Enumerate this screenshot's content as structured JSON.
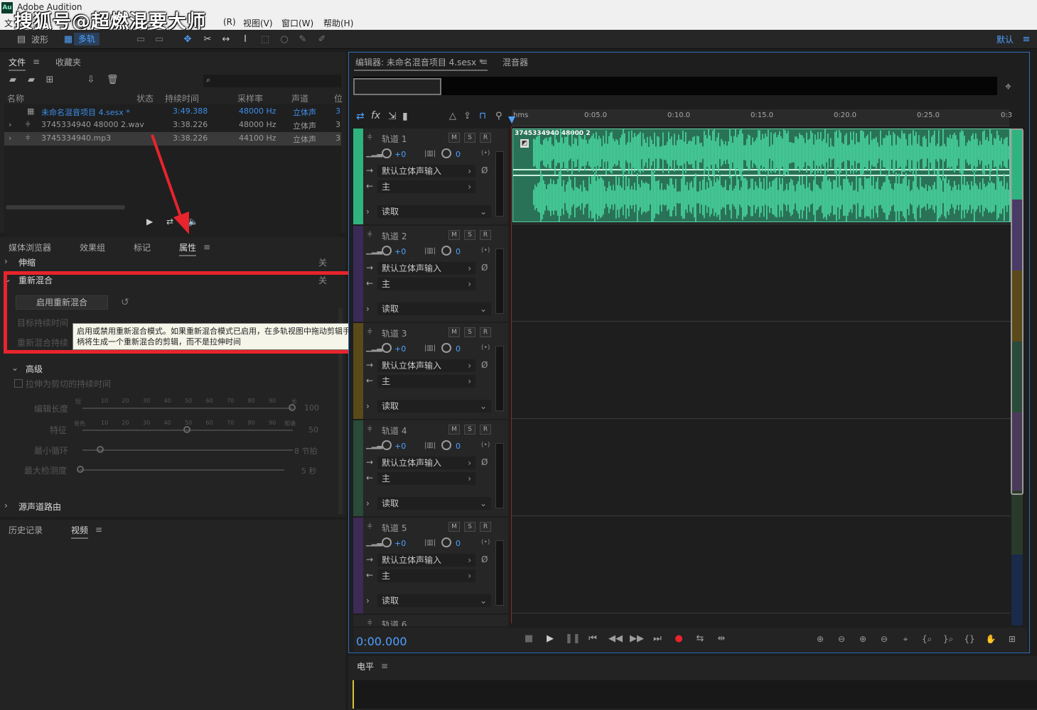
{
  "window": {
    "app_title": "Adobe Audition",
    "logo_text": "Au"
  },
  "watermark": "搜狐号@超燃混要大师",
  "menu": {
    "items": [
      "文",
      "(R)",
      "视图(V)",
      "窗口(W)",
      "帮助(H)"
    ]
  },
  "toolbar": {
    "waveform_label": "波形",
    "multitrack_label": "多轨",
    "workspace_label": "默认"
  },
  "files_panel": {
    "tabs": [
      "文件",
      "收藏夹"
    ],
    "search_placeholder": "",
    "columns": [
      "名称",
      "状态",
      "持续时间",
      "采样率",
      "声道",
      "位"
    ],
    "rows": [
      {
        "name": "未命名混音项目 4.sesx *",
        "duration": "3:49.388",
        "rate": "48000 Hz",
        "channels": "立体声",
        "bits": "3"
      },
      {
        "name": "3745334940 48000 2.wav",
        "duration": "3:38.226",
        "rate": "48000 Hz",
        "channels": "立体声",
        "bits": "3"
      },
      {
        "name": "3745334940.mp3",
        "duration": "3:38.226",
        "rate": "44100 Hz",
        "channels": "立体声",
        "bits": "3"
      }
    ]
  },
  "props_panel": {
    "tabs": [
      "媒体浏览器",
      "效果组",
      "标记",
      "属性"
    ],
    "sections": {
      "stretch": "伸缩",
      "remix": "重新混合",
      "close_label": "关",
      "enable_remix_button": "启用重新混合",
      "target_duration": "目标持续时间",
      "remix_duration": "重新混合持续",
      "advanced": "高级",
      "stretch_checkbox": "拉伸为剪切的持续时间",
      "edit_length": "编辑长度",
      "feature": "特征",
      "min_loop": "最小循环",
      "max_detect": "最大检测度",
      "source_routing": "源声道路由"
    },
    "slider_values": {
      "edit_length": "100",
      "feature": "50",
      "min_loop": "8 节拍",
      "max_detect": "5 秒"
    },
    "slider_ticks": [
      "10",
      "20",
      "30",
      "40",
      "50",
      "60",
      "70",
      "80",
      "90"
    ],
    "slider_end_labels": {
      "edit_left": "短",
      "edit_right": "长",
      "feature_left": "音色",
      "feature_right": "和谐"
    },
    "tooltip": "启用或禁用重新混合模式。如果重新混合模式已启用，在多轨视图中拖动剪辑手柄将生成一个重新混合的剪辑，而不是拉伸时间"
  },
  "bottom_left_panel": {
    "tabs": [
      "历史记录",
      "视频"
    ]
  },
  "editor": {
    "tab_title": "编辑器: 未命名混音项目 4.sesx *",
    "mixer_tab": "混音器",
    "ruler_labels": [
      "hms",
      "0:05.0",
      "0:10.0",
      "0:15.0",
      "0:20.0",
      "0:25.0",
      "0:3"
    ],
    "clip_label": "3745334940 48000 2",
    "time_display": "0:00.000",
    "tracks": [
      {
        "name": "轨道 1",
        "volume": "+0",
        "pan": "0",
        "input": "默认立体声输入",
        "output": "主",
        "mode": "读取",
        "color": "#2fb37f"
      },
      {
        "name": "轨道 2",
        "volume": "+0",
        "pan": "0",
        "input": "默认立体声输入",
        "output": "主",
        "mode": "读取",
        "color": "#3a2a55"
      },
      {
        "name": "轨道 3",
        "volume": "+0",
        "pan": "0",
        "input": "默认立体声输入",
        "output": "主",
        "mode": "读取",
        "color": "#5a4a1a"
      },
      {
        "name": "轨道 4",
        "volume": "+0",
        "pan": "0",
        "input": "默认立体声输入",
        "output": "主",
        "mode": "读取",
        "color": "#2a4a3a"
      },
      {
        "name": "轨道 5",
        "volume": "+0",
        "pan": "0",
        "input": "默认立体声输入",
        "output": "主",
        "mode": "读取",
        "color": "#3d2a55"
      },
      {
        "name": "轨道 6"
      }
    ],
    "track_buttons": [
      "M",
      "S",
      "R"
    ]
  },
  "levels_panel": {
    "title": "电平"
  }
}
